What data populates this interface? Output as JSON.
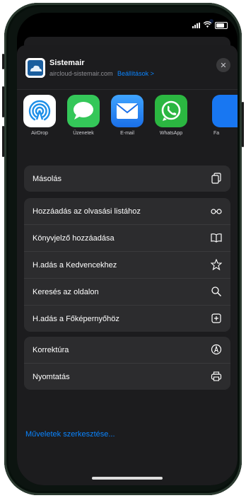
{
  "header": {
    "app_name": "Sistemair",
    "url": "aircloud-sistemair.com",
    "settings_link": "Beállítások >",
    "close_symbol": "✕"
  },
  "apps": [
    {
      "label": "AirDrop",
      "icon": "airdrop-icon",
      "color": "#ffffff"
    },
    {
      "label": "Üzenetek",
      "icon": "messages-icon",
      "color": "#34c759"
    },
    {
      "label": "E-mail",
      "icon": "mail-icon",
      "color": "#1a8cff"
    },
    {
      "label": "WhatsApp",
      "icon": "whatsapp-icon",
      "color": "#2bb741"
    },
    {
      "label": "Fa",
      "icon": "facebook-icon",
      "color": "#1877f2"
    }
  ],
  "actions": {
    "group1": [
      {
        "label": "Másolás",
        "icon": "copy-icon"
      }
    ],
    "group2": [
      {
        "label": "Hozzáadás az olvasási listához",
        "icon": "glasses-icon"
      },
      {
        "label": "Könyvjelző hozzáadása",
        "icon": "book-icon"
      },
      {
        "label": "H.adás a Kedvencekhez",
        "icon": "star-icon"
      },
      {
        "label": "Keresés az oldalon",
        "icon": "search-icon"
      },
      {
        "label": "H.adás a Főképernyőhöz",
        "icon": "add-square-icon"
      }
    ],
    "group3": [
      {
        "label": "Korrektúra",
        "icon": "markup-icon"
      },
      {
        "label": "Nyomtatás",
        "icon": "print-icon"
      }
    ]
  },
  "edit_actions": "Műveletek szerkesztése..."
}
